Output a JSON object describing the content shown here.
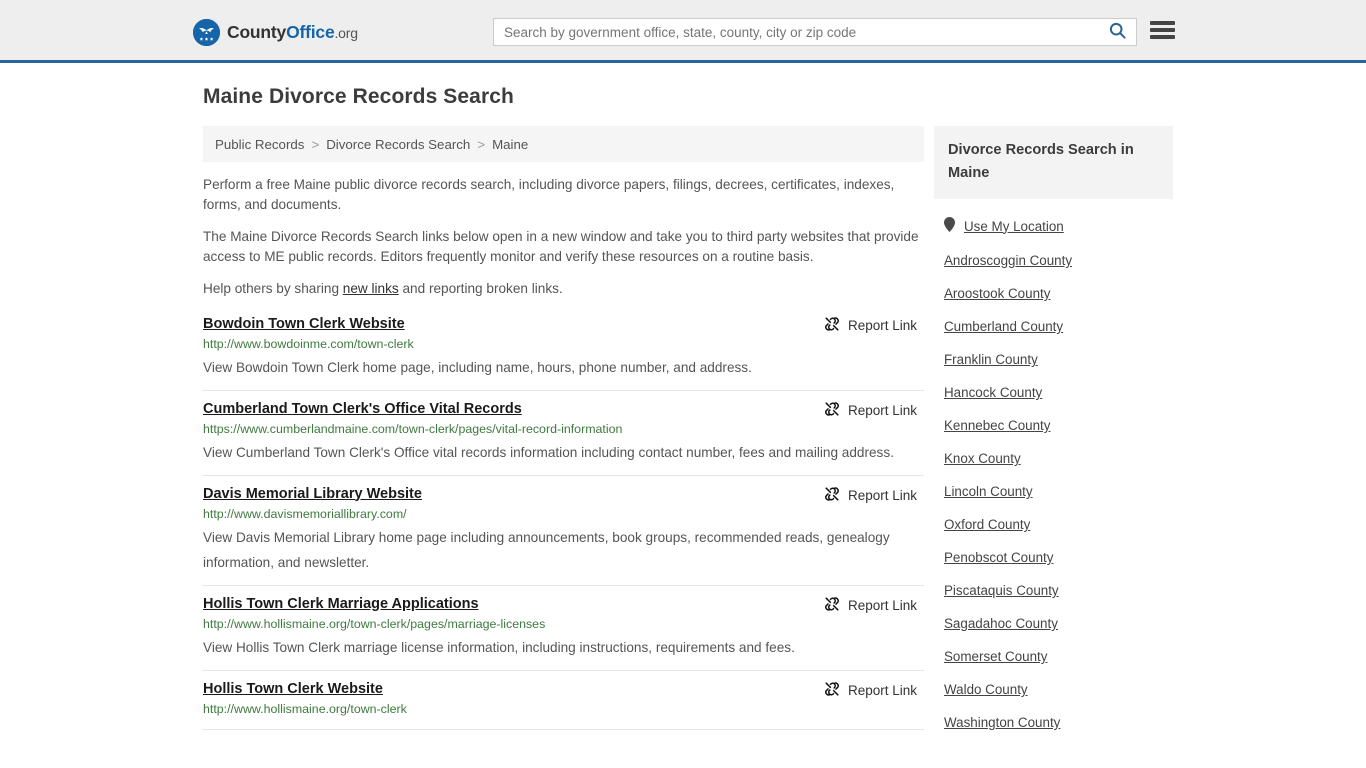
{
  "header": {
    "logo": {
      "part1": "County",
      "part2": "Office",
      "part3": ".org",
      "icon": "eagle-seal-icon"
    },
    "search": {
      "placeholder": "Search by government office, state, county, city or zip code",
      "value": "",
      "icon": "search-icon"
    },
    "menu_icon": "hamburger-menu-icon",
    "accent_color": "#2a6496",
    "background": "#eeeeee"
  },
  "page_title": "Maine Divorce Records Search",
  "breadcrumb": {
    "items": [
      "Public Records",
      "Divorce Records Search",
      "Maine"
    ],
    "separator": ">"
  },
  "intro": {
    "paragraph1": "Perform a free Maine public divorce records search, including divorce papers, filings, decrees, certificates, indexes, forms, and documents.",
    "paragraph2": "The Maine Divorce Records Search links below open in a new window and take you to third party websites that provide access to ME public records. Editors frequently monitor and verify these resources on a routine basis.",
    "paragraph3_pre": "Help others by sharing ",
    "paragraph3_link": "new links",
    "paragraph3_post": " and reporting broken links."
  },
  "report_label": "Report Link",
  "report_icon": "broken-link-icon",
  "results": [
    {
      "title": "Bowdoin Town Clerk Website",
      "url": "http://www.bowdoinme.com/town-clerk",
      "description": "View Bowdoin Town Clerk home page, including name, hours, phone number, and address."
    },
    {
      "title": "Cumberland Town Clerk's Office Vital Records",
      "url": "https://www.cumberlandmaine.com/town-clerk/pages/vital-record-information",
      "description": "View Cumberland Town Clerk's Office vital records information including contact number, fees and mailing address."
    },
    {
      "title": "Davis Memorial Library Website",
      "url": "http://www.davismemoriallibrary.com/",
      "description": "View Davis Memorial Library home page including announcements, book groups, recommended reads, genealogy information, and newsletter."
    },
    {
      "title": "Hollis Town Clerk Marriage Applications",
      "url": "http://www.hollismaine.org/town-clerk/pages/marriage-licenses",
      "description": "View Hollis Town Clerk marriage license information, including instructions, requirements and fees."
    },
    {
      "title": "Hollis Town Clerk Website",
      "url": "http://www.hollismaine.org/town-clerk",
      "description": ""
    }
  ],
  "sidebar": {
    "heading": "Divorce Records Search in Maine",
    "use_my_location": {
      "label": "Use My Location",
      "icon": "location-pin-icon"
    },
    "counties": [
      "Androscoggin County",
      "Aroostook County",
      "Cumberland County",
      "Franklin County",
      "Hancock County",
      "Kennebec County",
      "Knox County",
      "Lincoln County",
      "Oxford County",
      "Penobscot County",
      "Piscataquis County",
      "Sagadahoc County",
      "Somerset County",
      "Waldo County",
      "Washington County"
    ]
  },
  "colors": {
    "link_green": "#3f7a3f",
    "brand_blue": "#1565a8",
    "text_gray": "#555555"
  }
}
